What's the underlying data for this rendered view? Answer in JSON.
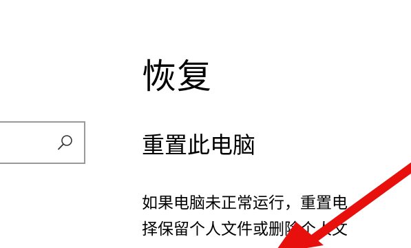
{
  "search": {
    "value": "",
    "placeholder": ""
  },
  "page": {
    "title": "恢复"
  },
  "reset_section": {
    "heading": "重置此电脑",
    "description_line_1": "如果电脑未正常运行，重置电",
    "description_line_2": "择保留个人文件或删除个人文"
  },
  "icons": {
    "search": "search-icon",
    "annotation": "red-arrow-icon"
  },
  "colors": {
    "background": "#ffffff",
    "text": "#000000",
    "search_border": "#999999",
    "arrow": "#e8100c"
  }
}
